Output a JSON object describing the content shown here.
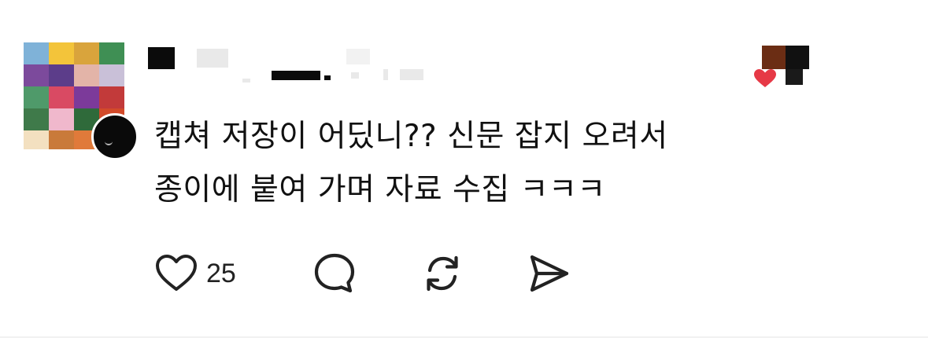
{
  "comment": {
    "lines": [
      "캡쳐 저장이 어딨니?? 신문 잡지 오려서",
      "종이에 붙여 가며 자료 수집 ㅋㅋㅋ"
    ]
  },
  "actions": {
    "like_count": "25",
    "like_icon": "heart-icon",
    "reply_icon": "speech-bubble-icon",
    "repost_icon": "repost-icon",
    "share_icon": "send-icon"
  },
  "colors": {
    "text": "#111111",
    "icon": "#222222",
    "redaction": "#0b0b0b"
  }
}
